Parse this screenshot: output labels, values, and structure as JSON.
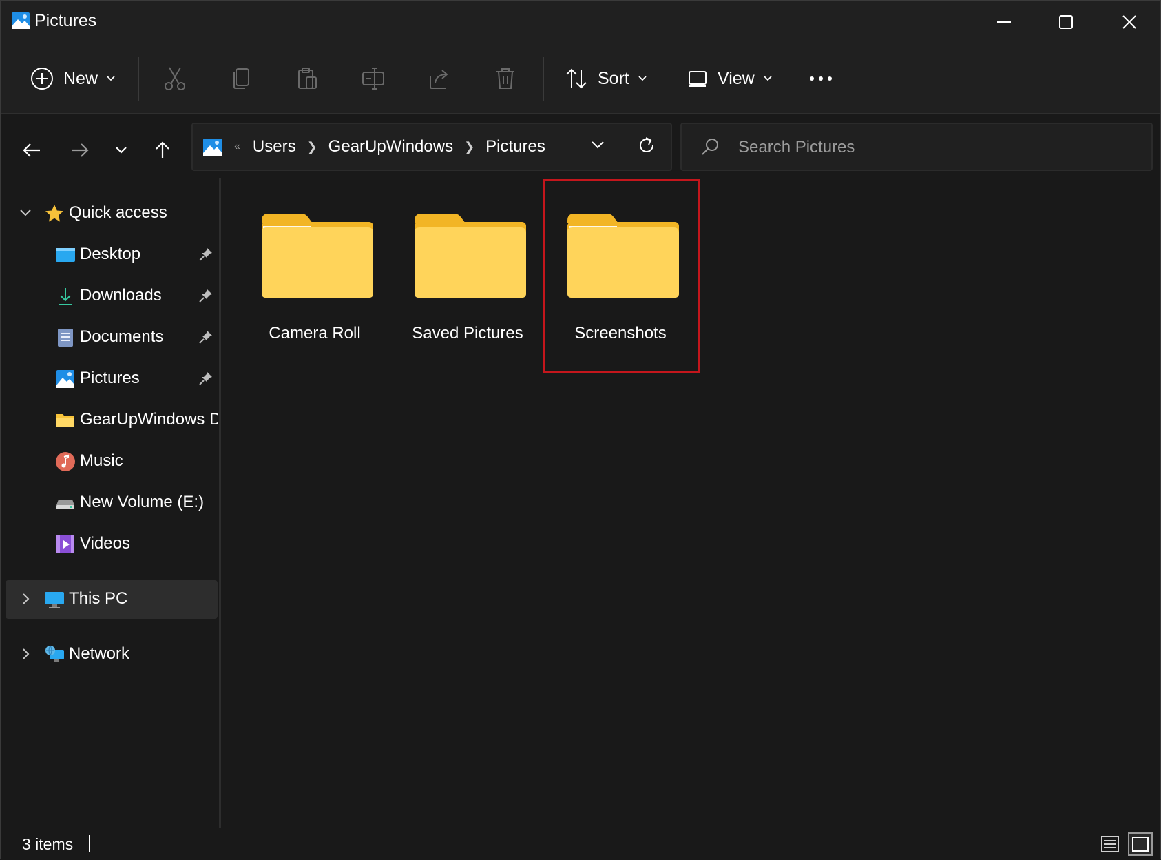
{
  "window": {
    "title": "Pictures",
    "controls": [
      "minimize-icon",
      "maximize-icon",
      "close-icon"
    ]
  },
  "command_bar": {
    "new_label": "New",
    "sort_label": "Sort",
    "view_label": "View",
    "tools": [
      "cut-icon",
      "copy-icon",
      "paste-icon",
      "rename-icon",
      "share-icon",
      "delete-icon"
    ]
  },
  "address_bar": {
    "crumbs": [
      "Users",
      "GearUpWindows",
      "Pictures"
    ],
    "overflow": "«"
  },
  "search": {
    "placeholder": "Search Pictures"
  },
  "sidebar": {
    "quick_access": "Quick access",
    "items": [
      {
        "label": "Desktop",
        "icon": "desktop-icon",
        "pinned": true
      },
      {
        "label": "Downloads",
        "icon": "downloads-icon",
        "pinned": true
      },
      {
        "label": "Documents",
        "icon": "documents-icon",
        "pinned": true
      },
      {
        "label": "Pictures",
        "icon": "pictures-icon",
        "pinned": true
      },
      {
        "label": "GearUpWindows D",
        "icon": "folder-icon",
        "pinned": false
      },
      {
        "label": "Music",
        "icon": "music-icon",
        "pinned": false
      },
      {
        "label": "New Volume (E:)",
        "icon": "drive-icon",
        "pinned": false
      },
      {
        "label": "Videos",
        "icon": "videos-icon",
        "pinned": false
      }
    ],
    "this_pc": "This PC",
    "network": "Network"
  },
  "content": {
    "folders": [
      {
        "name": "Camera Roll"
      },
      {
        "name": "Saved Pictures"
      },
      {
        "name": "Screenshots"
      }
    ],
    "highlighted_folder": "Screenshots",
    "highlight_color": "#c4161c"
  },
  "status_bar": {
    "item_count": "3 items"
  },
  "colors": {
    "background": "#191919",
    "chrome": "#202020",
    "folder_yellow": "#f8c43a",
    "accent_blue": "#1f8ee6"
  }
}
